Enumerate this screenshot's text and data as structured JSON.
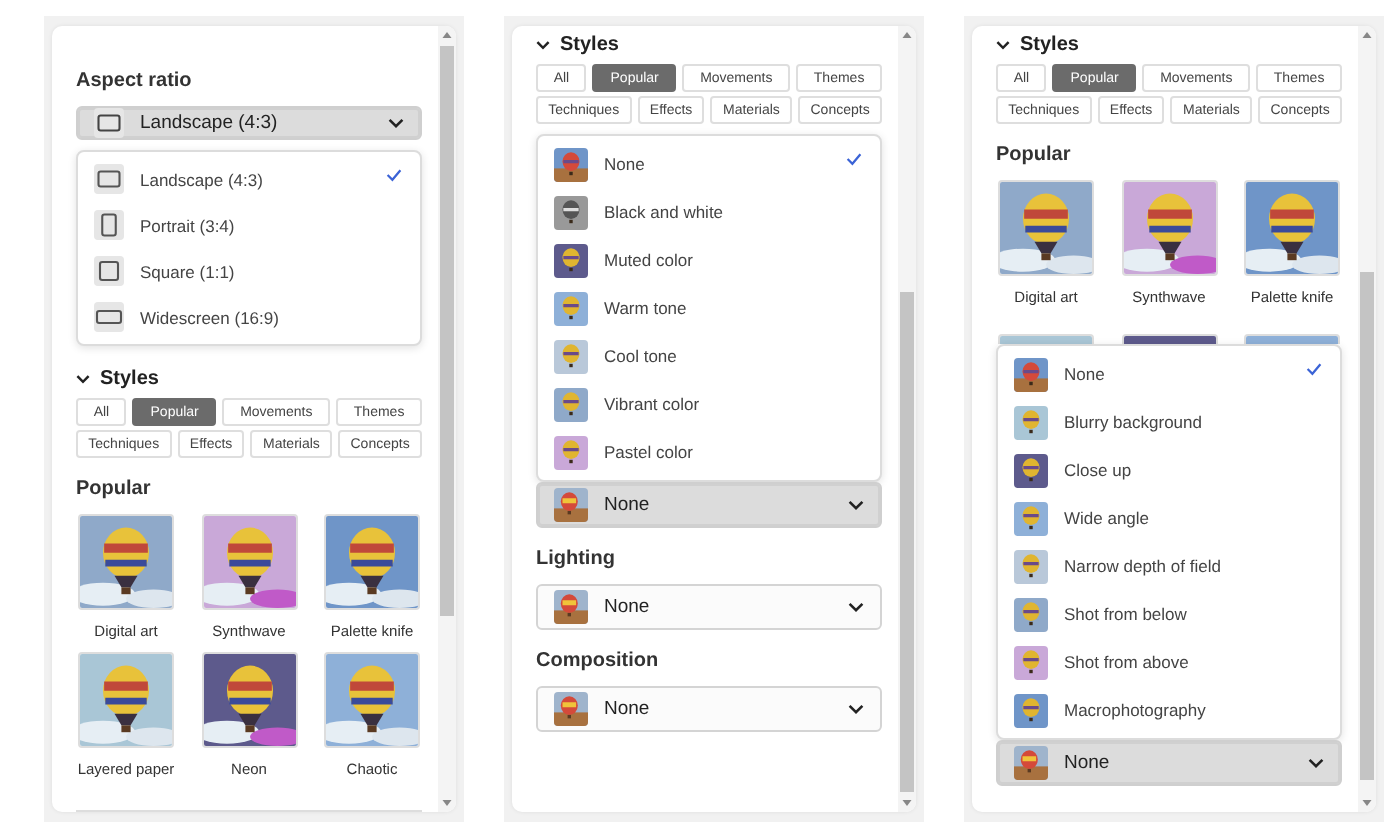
{
  "panels": [
    {
      "blocks": [
        {
          "kind": "label",
          "text": "Aspect ratio"
        },
        {
          "kind": "dropdown",
          "value": {
            "kind": "landscape",
            "label": "Landscape (4:3)"
          },
          "expanded": true
        },
        {
          "kind": "menu",
          "items": [
            {
              "label": "Landscape (4:3)",
              "kind": "landscape",
              "selected": true
            },
            {
              "label": "Portrait (3:4)",
              "kind": "portrait",
              "selected": false
            },
            {
              "label": "Square (1:1)",
              "kind": "square",
              "selected": false
            },
            {
              "label": "Widescreen (16:9)",
              "kind": "widescreen",
              "selected": false
            }
          ]
        },
        {
          "kind": "toggle",
          "text": "Styles",
          "expanded": true
        },
        {
          "kind": "chips",
          "rows": [
            [
              {
                "label": "All",
                "selected": false
              },
              {
                "label": "Popular",
                "selected": true
              },
              {
                "label": "Movements",
                "selected": false
              },
              {
                "label": "Themes",
                "selected": false
              }
            ],
            [
              {
                "label": "Techniques",
                "selected": false
              },
              {
                "label": "Effects",
                "selected": false
              },
              {
                "label": "Materials",
                "selected": false
              },
              {
                "label": "Concepts",
                "selected": false
              }
            ]
          ]
        },
        {
          "kind": "label",
          "text": "Popular"
        },
        {
          "kind": "gallery",
          "items": [
            {
              "label": "Digital art"
            },
            {
              "label": "Synthwave"
            },
            {
              "label": "Palette knife"
            },
            {
              "label": "Layered paper"
            },
            {
              "label": "Neon"
            },
            {
              "label": "Chaotic"
            }
          ]
        },
        {
          "kind": "divider"
        }
      ]
    },
    {
      "blocks": [
        {
          "kind": "toggle",
          "text": "Styles",
          "expanded": true
        },
        {
          "kind": "chips",
          "rows": [
            [
              {
                "label": "All",
                "selected": false
              },
              {
                "label": "Popular",
                "selected": true
              },
              {
                "label": "Movements",
                "selected": false
              },
              {
                "label": "Themes",
                "selected": false
              }
            ],
            [
              {
                "label": "Techniques",
                "selected": false
              },
              {
                "label": "Effects",
                "selected": false
              },
              {
                "label": "Materials",
                "selected": false
              },
              {
                "label": "Concepts",
                "selected": false
              }
            ]
          ]
        },
        {
          "kind": "menu",
          "items": [
            {
              "label": "None",
              "kind": "picture",
              "selected": true
            },
            {
              "label": "Black and white",
              "kind": "picture",
              "selected": false
            },
            {
              "label": "Muted color",
              "kind": "picture",
              "selected": false
            },
            {
              "label": "Warm tone",
              "kind": "picture",
              "selected": false
            },
            {
              "label": "Cool tone",
              "kind": "picture",
              "selected": false
            },
            {
              "label": "Vibrant color",
              "kind": "picture",
              "selected": false
            },
            {
              "label": "Pastel color",
              "kind": "picture",
              "selected": false
            }
          ]
        },
        {
          "kind": "dropdown",
          "value": {
            "kind": "picture",
            "label": "None"
          },
          "expanded": true
        },
        {
          "kind": "label",
          "text": "Lighting"
        },
        {
          "kind": "dropdown",
          "value": {
            "kind": "picture",
            "label": "None"
          },
          "expanded": false
        },
        {
          "kind": "label",
          "text": "Composition"
        },
        {
          "kind": "dropdown",
          "value": {
            "kind": "picture",
            "label": "None"
          },
          "expanded": false
        }
      ]
    },
    {
      "blocks": [
        {
          "kind": "toggle",
          "text": "Styles",
          "expanded": true
        },
        {
          "kind": "chips",
          "rows": [
            [
              {
                "label": "All",
                "selected": false
              },
              {
                "label": "Popular",
                "selected": true
              },
              {
                "label": "Movements",
                "selected": false
              },
              {
                "label": "Themes",
                "selected": false
              }
            ],
            [
              {
                "label": "Techniques",
                "selected": false
              },
              {
                "label": "Effects",
                "selected": false
              },
              {
                "label": "Materials",
                "selected": false
              },
              {
                "label": "Concepts",
                "selected": false
              }
            ]
          ]
        },
        {
          "kind": "label",
          "text": "Popular"
        },
        {
          "kind": "gallery",
          "items": [
            {
              "label": "Digital art"
            },
            {
              "label": "Synthwave"
            },
            {
              "label": "Palette knife"
            }
          ]
        },
        {
          "kind": "peek_gallery"
        },
        {
          "kind": "menu",
          "items": [
            {
              "label": "None",
              "kind": "picture",
              "selected": true
            },
            {
              "label": "Blurry background",
              "kind": "picture",
              "selected": false
            },
            {
              "label": "Close up",
              "kind": "picture",
              "selected": false
            },
            {
              "label": "Wide angle",
              "kind": "picture",
              "selected": false
            },
            {
              "label": "Narrow depth of field",
              "kind": "picture",
              "selected": false
            },
            {
              "label": "Shot from below",
              "kind": "picture",
              "selected": false
            },
            {
              "label": "Shot from above",
              "kind": "picture",
              "selected": false
            },
            {
              "label": "Macrophotography",
              "kind": "picture",
              "selected": false
            }
          ]
        },
        {
          "kind": "dropdown",
          "value": {
            "kind": "picture",
            "label": "None"
          },
          "expanded": true
        }
      ]
    }
  ]
}
